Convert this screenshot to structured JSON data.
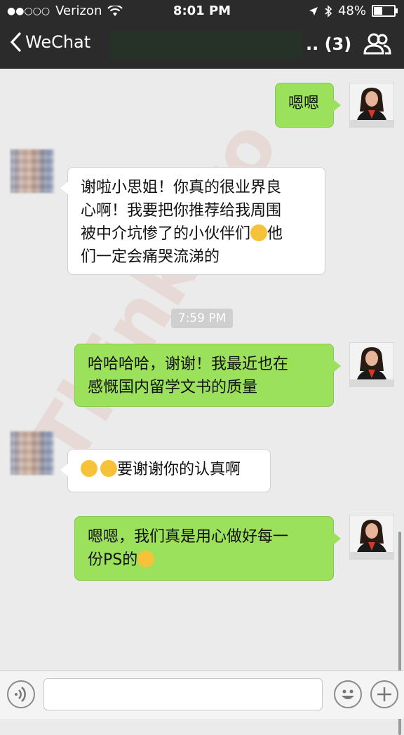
{
  "status_bar": {
    "signal": "●●○○○",
    "carrier": "Verizon",
    "time": "8:01 PM",
    "battery": "48%",
    "battery_level": 0.48
  },
  "nav": {
    "back_label": "WeChat",
    "title": ".. (3)"
  },
  "messages": [
    {
      "side": "right",
      "color": "green",
      "text": "嗯嗯"
    },
    {
      "side": "left",
      "color": "white",
      "lines": [
        "谢啦小思姐！你真的很业界良",
        "心啊！我要把你推荐给我周围",
        "被中介坑惨了的小伙伴们",
        "们一定会痛哭流涕的"
      ],
      "inline_tail": "他"
    },
    {
      "timestamp": "7:59 PM"
    },
    {
      "side": "right",
      "color": "green",
      "lines": [
        "哈哈哈哈，谢谢！我最近也在",
        "感慨国内留学文书的质量"
      ]
    },
    {
      "side": "left",
      "color": "white",
      "text": "要谢谢你的认真啊"
    },
    {
      "side": "right",
      "color": "green",
      "lines": [
        "嗯嗯，我们真是用心做好每一",
        "份PS的"
      ]
    }
  ],
  "watermark": "ThinkPro",
  "colors": {
    "bar": "#2b2b2b",
    "green_bubble": "#9be15b",
    "background": "#ebebeb"
  }
}
